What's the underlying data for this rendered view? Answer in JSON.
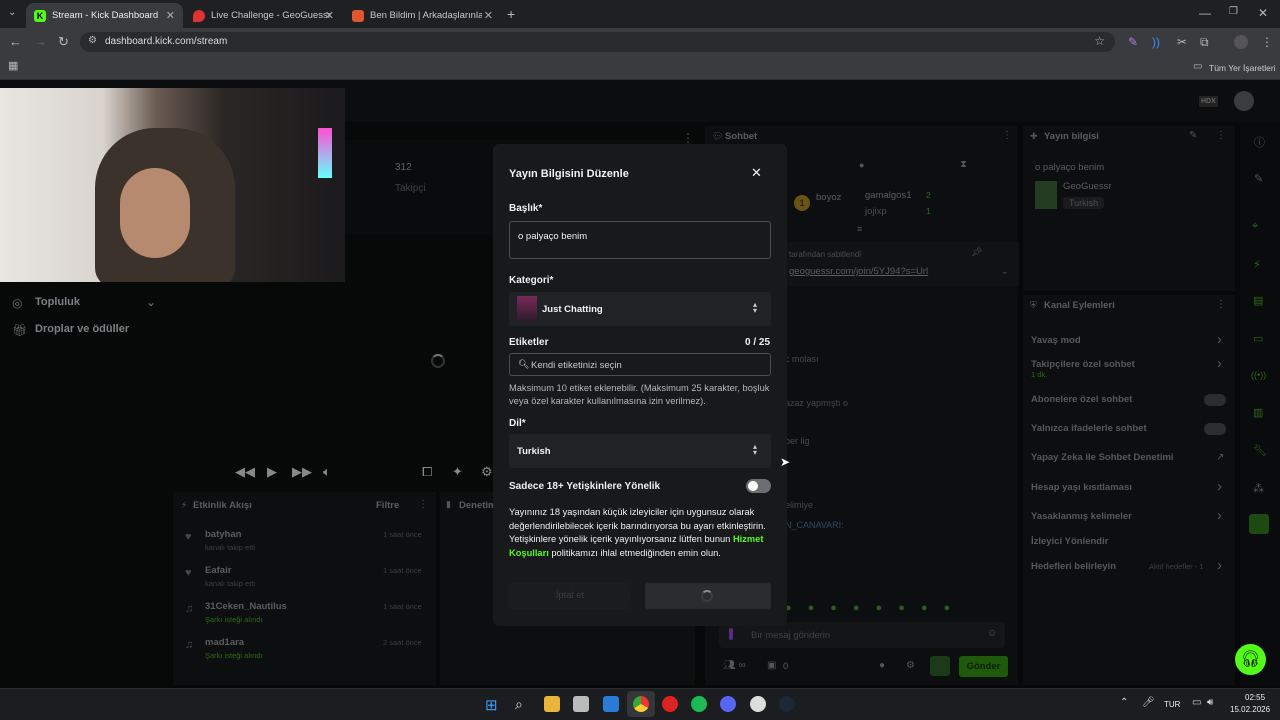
{
  "browser": {
    "tabs": [
      {
        "title": "Stream - Kick Dashboard",
        "icon": "kick-logo-icon",
        "active": true
      },
      {
        "title": "Live Challenge - GeoGuessr",
        "icon": "map-pin-icon",
        "active": false
      },
      {
        "title": "Ben Bildim | Arkadaşlarınla Onli",
        "icon": "game-icon",
        "active": false
      }
    ],
    "url": "dashboard.kick.com/stream",
    "bookmarks_label": "Tüm Yer İşaretleri"
  },
  "left": {
    "followers_count": "312",
    "followers_label": "Takipçi",
    "nav_community": "Topluluk",
    "nav_drops": "Droplar ve ödüller"
  },
  "activity": {
    "title": "Etkinlik Akışı",
    "filter": "Filtre",
    "next_panel": "Denetim",
    "items": [
      {
        "user": "batyhan",
        "action": "kanalı takip etti",
        "time": "1 saat önce"
      },
      {
        "user": "Eafair",
        "action": "kanalı takip etti",
        "time": "1 saat önce"
      },
      {
        "user": "31Ceken_Nautilus",
        "action": "Şarkı isteği alındı",
        "time": "1 saat önce"
      },
      {
        "user": "mad1ara",
        "action": "Şarkı isteği alındı",
        "time": "2 saat önce"
      }
    ]
  },
  "chat": {
    "title": "Sohbet",
    "top_users": [
      {
        "name": "boyoz",
        "rank": "1"
      },
      {
        "name": "gamalgos1",
        "count": "2"
      },
      {
        "name": "jojixp",
        "count": "1"
      }
    ],
    "pinned_label": "tarafından sabitlendi",
    "pinned_link": "geoguessr.com/join/5YJ94?s=Url",
    "messages": [
      "c molası",
      "azaz yapmıştı o",
      "per lig",
      "elimiye",
      "N_CANAVARI:"
    ],
    "input_placeholder": "Bir mesaj gönderin",
    "count": "0",
    "send_button": "Gönder"
  },
  "stream_info": {
    "title": "Yayın bilgisi",
    "stream_title": "o palyaço benim",
    "category": "GeoGuessr",
    "language": "Turkish"
  },
  "channel_actions": {
    "title": "Kanal Eylemleri",
    "items": [
      {
        "label": "Yavaş mod",
        "control": "chevron"
      },
      {
        "label": "Takipçilere özel sohbet",
        "sub": "1 dk.",
        "control": "chevron"
      },
      {
        "label": "Abonelere özel sohbet",
        "control": "toggle"
      },
      {
        "label": "Yalnızca ifadelerle sohbet",
        "control": "toggle"
      },
      {
        "label": "Yapay Zeka ile Sohbet Denetimi",
        "control": "link"
      },
      {
        "label": "Hesap yaşı kısıtlaması",
        "control": "chevron"
      },
      {
        "label": "Yasaklanmış kelimeler",
        "control": "chevron"
      },
      {
        "label": "İzleyici Yönlendir",
        "control": "none"
      },
      {
        "label": "Hedefleri belirleyin",
        "sub": "Aktif hedefler - 1",
        "control": "chevron"
      }
    ]
  },
  "modal": {
    "title": "Yayın Bilgisini Düzenle",
    "title_label": "Başlık*",
    "title_value": "o palyaço benim",
    "category_label": "Kategori*",
    "category_value": "Just Chatting",
    "tags_label": "Etiketler",
    "tags_count": "0 / 25",
    "tags_placeholder": "Kendi etiketinizi seçin",
    "tags_hint": "Maksimum 10 etiket eklenebilir. (Maksimum 25 karakter, boşluk veya özel karakter kullanılmasına izin verilmez).",
    "language_label": "Dil*",
    "language_value": "Turkish",
    "adult_label": "Sadece 18+ Yetişkinlere Yönelik",
    "adult_text_1": "Yayınınız 18 yaşından küçük izleyiciler için uygunsuz olarak değerlendirilebilecek içerik barındırıyorsa bu ayarı etkinleştirin. Yetişkinlere yönelik içerik yayınlıyorsanız lütfen bunun ",
    "adult_link": "Hizmet Koşulları",
    "adult_text_2": " politikamızı ihlal etmediğinden emin olun.",
    "cancel_button": "İptal et"
  },
  "taskbar": {
    "lang": "TUR",
    "time": "02:55",
    "date": "15.02.2026"
  },
  "colors": {
    "accent": "#53fc18",
    "bg": "#0b0c0d",
    "modal": "#17191b"
  }
}
